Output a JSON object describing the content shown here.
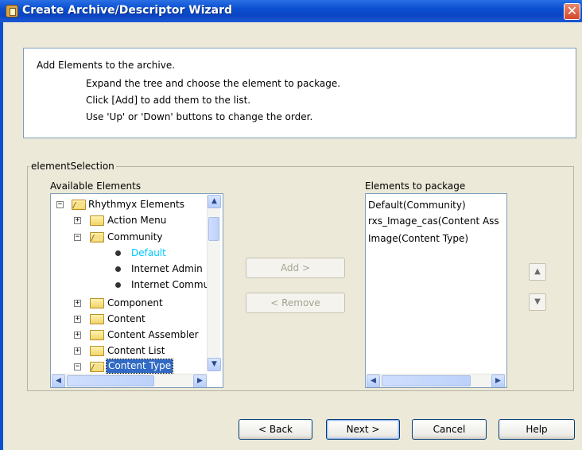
{
  "window": {
    "title": "Create Archive/Descriptor Wizard",
    "close_label": "✕"
  },
  "info": {
    "heading": "Add Elements to the archive.",
    "lines": [
      "Expand the tree and choose the element to package.",
      "Click [Add] to add them to the list.",
      "Use 'Up' or 'Down' buttons to change the order."
    ]
  },
  "selection": {
    "legend": "elementSelection",
    "available_label": "Available Elements",
    "package_label": "Elements to package",
    "tree": [
      {
        "label": "Rhythmyx Elements",
        "expander": "−",
        "icon": "folder-open"
      },
      {
        "label": "Action Menu",
        "expander": "+",
        "icon": "folder"
      },
      {
        "label": "Community",
        "expander": "−",
        "icon": "folder-open"
      },
      {
        "label": "Default",
        "icon": "bullet",
        "state": "highlighted"
      },
      {
        "label": "Internet Admin",
        "icon": "bullet"
      },
      {
        "label": "Internet Commu",
        "icon": "bullet"
      },
      {
        "label": "Component",
        "expander": "+",
        "icon": "folder"
      },
      {
        "label": "Content",
        "expander": "+",
        "icon": "folder"
      },
      {
        "label": "Content Assembler",
        "expander": "+",
        "icon": "folder"
      },
      {
        "label": "Content List",
        "expander": "+",
        "icon": "folder"
      },
      {
        "label": "Content Type",
        "expander": "−",
        "icon": "folder-open",
        "state": "selected"
      }
    ],
    "package_items": [
      "Default(Community)",
      "rxs_Image_cas(Content Ass",
      "Image(Content Type)"
    ],
    "add_label": "Add >",
    "remove_label": "< Remove",
    "up_label": "▲",
    "down_label": "▼"
  },
  "footer": {
    "back_label": "< Back",
    "next_label": "Next >",
    "cancel_label": "Cancel",
    "help_label": "Help"
  },
  "colors": {
    "highlight_text": "#00c8ff",
    "selection_bg": "#316ac5",
    "title_bar": "#0a4fd0"
  }
}
